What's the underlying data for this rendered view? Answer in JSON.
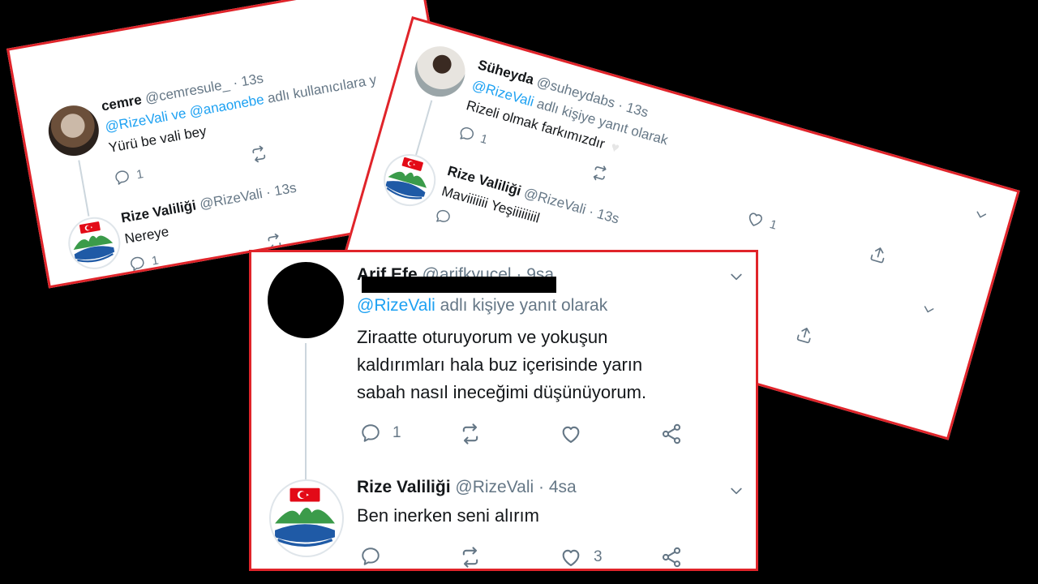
{
  "card_a": {
    "tweet": {
      "name": "cemre",
      "handle": "@cemresule_",
      "time": "· 13s",
      "reply_mention_1": "@RizeVali",
      "reply_and": "ve",
      "reply_mention_2": "@anaonebe",
      "reply_suffix": "adlı kullanıcılara y",
      "text": "Yürü be vali bey",
      "reply_count": "1"
    },
    "reply": {
      "name": "Rize Valiliği",
      "handle": "@RizeVali",
      "time": "· 13s",
      "text": "Nereye",
      "reply_count": "1"
    }
  },
  "card_b": {
    "tweet": {
      "name": "Süheyda",
      "handle": "@suheydabs",
      "time": "· 13s",
      "reply_mention": "@RizeVali",
      "reply_suffix": "adlı kişiye yanıt olarak",
      "text": "Rizeli olmak farkımızdır",
      "reply_count": "1"
    },
    "reply": {
      "name": "Rize Valiliği",
      "handle": "@RizeVali",
      "time": "· 13s",
      "text": "Maviiiiiii Yeşiiiiiiiil",
      "like_count": "1"
    }
  },
  "card_c": {
    "tweet": {
      "name": "Arif Efe",
      "handle": "@arifkyucel",
      "time": "· 9sa",
      "reply_mention": "@RizeVali",
      "reply_suffix": "adlı kişiye yanıt olarak",
      "text_line1": "Ziraatte oturuyorum ve yokuşun",
      "text_line2": "kaldırımları hala buz içerisinde yarın",
      "text_line3": "sabah nasıl ineceğimi düşünüyorum.",
      "reply_count": "1"
    },
    "reply": {
      "name": "Rize Valiliği",
      "handle": "@RizeVali",
      "time": "· 4sa",
      "text": "Ben inerken seni alırım",
      "like_count": "3"
    }
  },
  "colors": {
    "border": "#e0242a",
    "link": "#1da1f2",
    "muted": "#657786",
    "text": "#14171a"
  },
  "icons": [
    "reply-icon",
    "retweet-icon",
    "like-icon",
    "share-icon",
    "chevron-down-icon",
    "upload-icon"
  ]
}
